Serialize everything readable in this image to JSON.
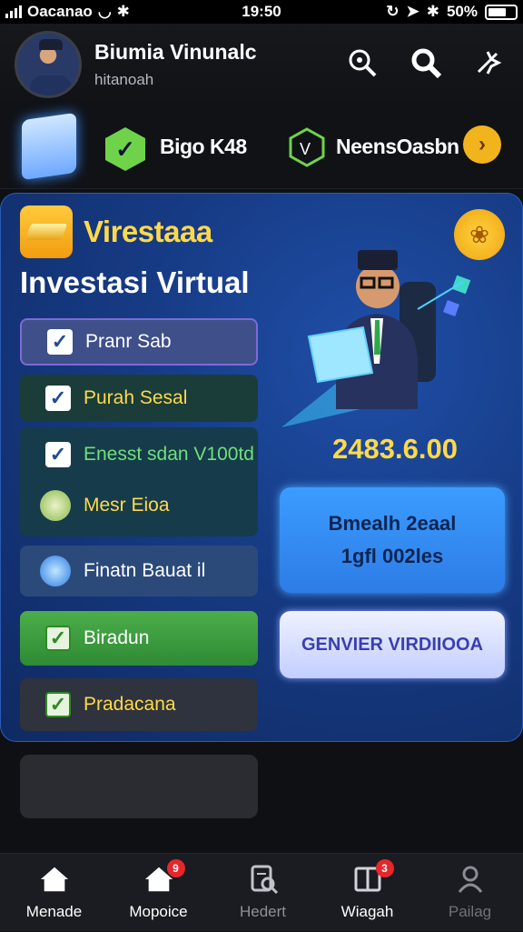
{
  "status": {
    "carrier": "Oacanao",
    "time": "19:50",
    "battery": "50%"
  },
  "header": {
    "title": "Biumia Vinunalc",
    "subtitle": "hitanoah"
  },
  "strip": {
    "item1": "Bigo K48",
    "item2": "NeensOasbn"
  },
  "panel": {
    "brand": "Virestaaa",
    "heading": "Investasi Virtual",
    "options": [
      {
        "label": "Pranr Sab"
      },
      {
        "label": "Purah Sesal"
      },
      {
        "label": "Enesst sdan V100td"
      },
      {
        "label": "Mesr Eioa"
      },
      {
        "label": "Finatn Bauat il"
      },
      {
        "label": "Biradun"
      },
      {
        "label": "Pradacana"
      }
    ],
    "amount": "2483.6.00",
    "info_line1": "Bmealh 2eaal",
    "info_line2": "1gfl 002les",
    "cta": "GENVIER VIRDIIOOA"
  },
  "tabs": [
    {
      "label": "Menade",
      "icon": "home-icon"
    },
    {
      "label": "Mopoice",
      "icon": "home-alert-icon",
      "badge": "9"
    },
    {
      "label": "Hedert",
      "icon": "receipt-search-icon"
    },
    {
      "label": "Wiagah",
      "icon": "book-icon",
      "badge": "3"
    },
    {
      "label": "Pailag",
      "icon": "profile-icon"
    }
  ]
}
